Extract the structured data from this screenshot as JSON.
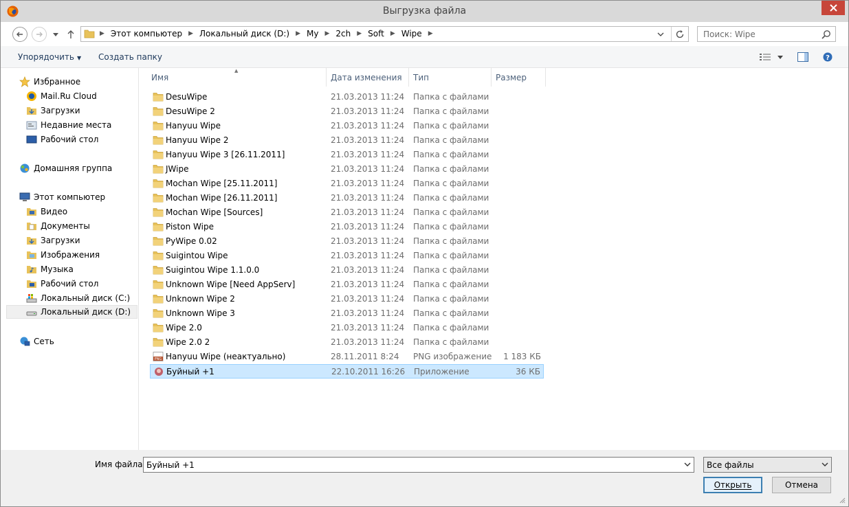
{
  "window": {
    "title": "Выгрузка файла"
  },
  "address": {
    "crumbs": [
      "Этот компьютер",
      "Локальный диск (D:)",
      "My",
      "2ch",
      "Soft",
      "Wipe"
    ]
  },
  "search": {
    "placeholder": "Поиск: Wipe"
  },
  "toolbar": {
    "organize_label": "Упорядочить",
    "new_folder_label": "Создать папку"
  },
  "sidebar": {
    "favorites": {
      "label": "Избранное",
      "items": [
        "Mail.Ru Cloud",
        "Загрузки",
        "Недавние места",
        "Рабочий стол"
      ]
    },
    "homegroup": {
      "label": "Домашняя группа"
    },
    "computer": {
      "label": "Этот компьютер",
      "items": [
        "Видео",
        "Документы",
        "Загрузки",
        "Изображения",
        "Музыка",
        "Рабочий стол",
        "Локальный диск (C:)",
        "Локальный диск (D:)"
      ]
    },
    "network": {
      "label": "Сеть"
    },
    "selected": "Локальный диск (D:)"
  },
  "columns": {
    "name": "Имя",
    "date": "Дата изменения",
    "type": "Тип",
    "size": "Размер"
  },
  "files": [
    {
      "name": "DesuWipe",
      "date": "21.03.2013 11:24",
      "type": "Папка с файлами",
      "size": "",
      "kind": "folder"
    },
    {
      "name": "DesuWipe 2",
      "date": "21.03.2013 11:24",
      "type": "Папка с файлами",
      "size": "",
      "kind": "folder"
    },
    {
      "name": "Hanyuu Wipe",
      "date": "21.03.2013 11:24",
      "type": "Папка с файлами",
      "size": "",
      "kind": "folder"
    },
    {
      "name": "Hanyuu Wipe 2",
      "date": "21.03.2013 11:24",
      "type": "Папка с файлами",
      "size": "",
      "kind": "folder"
    },
    {
      "name": "Hanyuu Wipe 3 [26.11.2011]",
      "date": "21.03.2013 11:24",
      "type": "Папка с файлами",
      "size": "",
      "kind": "folder"
    },
    {
      "name": "JWipe",
      "date": "21.03.2013 11:24",
      "type": "Папка с файлами",
      "size": "",
      "kind": "folder"
    },
    {
      "name": "Mochan Wipe [25.11.2011]",
      "date": "21.03.2013 11:24",
      "type": "Папка с файлами",
      "size": "",
      "kind": "folder"
    },
    {
      "name": "Mochan Wipe [26.11.2011]",
      "date": "21.03.2013 11:24",
      "type": "Папка с файлами",
      "size": "",
      "kind": "folder"
    },
    {
      "name": "Mochan Wipe [Sources]",
      "date": "21.03.2013 11:24",
      "type": "Папка с файлами",
      "size": "",
      "kind": "folder"
    },
    {
      "name": "Piston Wipe",
      "date": "21.03.2013 11:24",
      "type": "Папка с файлами",
      "size": "",
      "kind": "folder"
    },
    {
      "name": "PyWipe 0.02",
      "date": "21.03.2013 11:24",
      "type": "Папка с файлами",
      "size": "",
      "kind": "folder"
    },
    {
      "name": "Suigintou Wipe",
      "date": "21.03.2013 11:24",
      "type": "Папка с файлами",
      "size": "",
      "kind": "folder"
    },
    {
      "name": "Suigintou Wipe 1.1.0.0",
      "date": "21.03.2013 11:24",
      "type": "Папка с файлами",
      "size": "",
      "kind": "folder"
    },
    {
      "name": "Unknown Wipe [Need AppServ]",
      "date": "21.03.2013 11:24",
      "type": "Папка с файлами",
      "size": "",
      "kind": "folder"
    },
    {
      "name": "Unknown Wipe 2",
      "date": "21.03.2013 11:24",
      "type": "Папка с файлами",
      "size": "",
      "kind": "folder"
    },
    {
      "name": "Unknown Wipe 3",
      "date": "21.03.2013 11:24",
      "type": "Папка с файлами",
      "size": "",
      "kind": "folder"
    },
    {
      "name": "Wipe 2.0",
      "date": "21.03.2013 11:24",
      "type": "Папка с файлами",
      "size": "",
      "kind": "folder"
    },
    {
      "name": "Wipe 2.0 2",
      "date": "21.03.2013 11:24",
      "type": "Папка с файлами",
      "size": "",
      "kind": "folder"
    },
    {
      "name": "Hanyuu Wipe (неактуально)",
      "date": "28.11.2011 8:24",
      "type": "PNG изображение",
      "size": "1 183 КБ",
      "kind": "png"
    },
    {
      "name": "Буйный +1",
      "date": "22.10.2011 16:26",
      "type": "Приложение",
      "size": "36 КБ",
      "kind": "app",
      "selected": true
    }
  ],
  "filename": {
    "label": "Имя файла:",
    "value": "Буйный +1"
  },
  "filter": {
    "value": "Все файлы"
  },
  "buttons": {
    "open": "Открыть",
    "cancel": "Отмена"
  },
  "colors": {
    "selection_bg": "#cce8ff",
    "selection_border": "#99d1ff",
    "folder": "#e8c25a",
    "close": "#c7463a"
  }
}
